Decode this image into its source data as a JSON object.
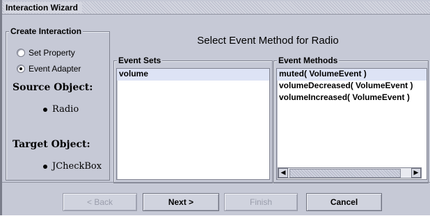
{
  "window": {
    "title": "Interaction Wizard"
  },
  "create_interaction": {
    "legend": "Create Interaction",
    "options": [
      {
        "label": "Set Property",
        "selected": false
      },
      {
        "label": "Event Adapter",
        "selected": true
      }
    ],
    "source_label": "Source Object:",
    "source_value": "Radio",
    "target_label": "Target Object:",
    "target_value": "JCheckBox"
  },
  "main": {
    "heading": "Select Event Method for Radio",
    "event_sets": {
      "legend": "Event Sets",
      "items": [
        "volume"
      ],
      "selected": 0
    },
    "event_methods": {
      "legend": "Event Methods",
      "items": [
        "muted( VolumeEvent )",
        "volumeDecreased( VolumeEvent )",
        "volumeIncreased( VolumeEvent )"
      ],
      "selected": 0
    }
  },
  "buttons": {
    "back": "< Back",
    "next": "Next >",
    "finish": "Finish",
    "cancel": "Cancel"
  },
  "colors": {
    "dialog_background": "#c6c9d6",
    "selection": "#dde3f5",
    "disabled_text": "#9a9dab"
  }
}
